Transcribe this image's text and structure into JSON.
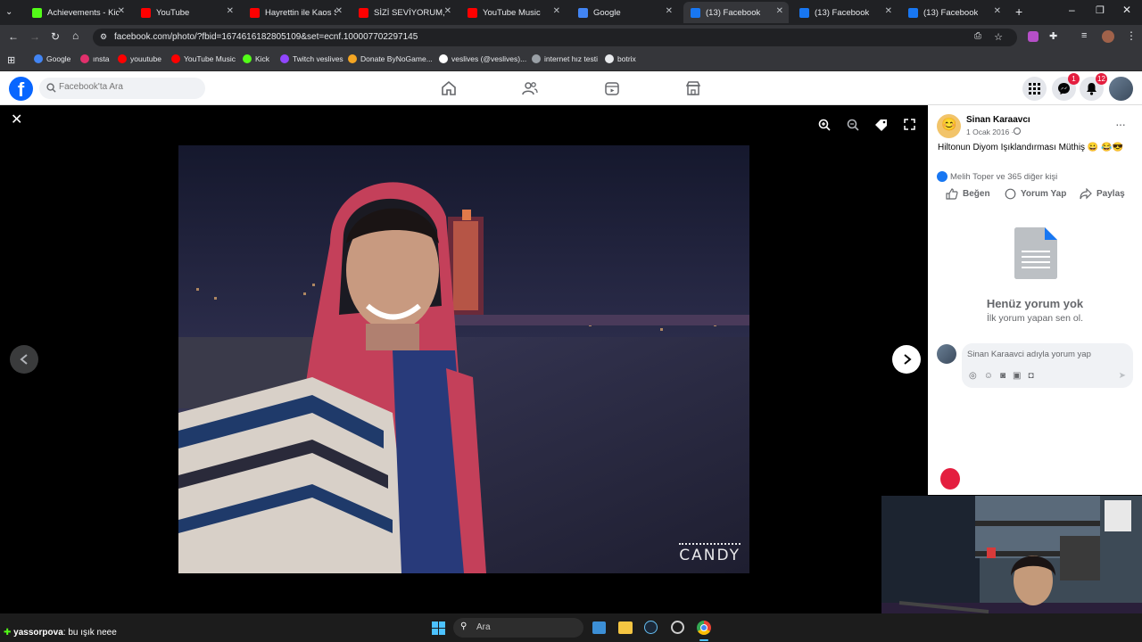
{
  "browser": {
    "tabs": [
      {
        "title": "Achievements - Kick",
        "color": "#53fc18",
        "active": false
      },
      {
        "title": "YouTube",
        "color": "#ff0000",
        "active": false
      },
      {
        "title": "Hayrettin ile Kaos Sh",
        "color": "#ff0000",
        "active": false
      },
      {
        "title": "SİZİ SEVİYORUM, SİZİ",
        "color": "#ff0000",
        "active": false
      },
      {
        "title": "YouTube Music",
        "color": "#ff0000",
        "active": false
      },
      {
        "title": "Google",
        "color": "#4285f4",
        "active": false
      },
      {
        "title": "(13) Facebook",
        "color": "#1877f2",
        "active": true
      },
      {
        "title": "(13) Facebook",
        "color": "#1877f2",
        "active": false
      },
      {
        "title": "(13) Facebook",
        "color": "#1877f2",
        "active": false
      }
    ],
    "url": "facebook.com/photo/?fbid=1674616182805109&set=ecnf.100007702297145",
    "bookmarks": [
      {
        "label": "Google",
        "color": "#4285f4"
      },
      {
        "label": "ınsta",
        "color": "#e1306c"
      },
      {
        "label": "youutube",
        "color": "#ff0000"
      },
      {
        "label": "YouTube Music",
        "color": "#ff0000"
      },
      {
        "label": "Kick",
        "color": "#53fc18"
      },
      {
        "label": "Twitch veslives",
        "color": "#9146ff"
      },
      {
        "label": "Donate ByNoGame...",
        "color": "#f5a623"
      },
      {
        "label": "veslives (@veslives)...",
        "color": "#ffffff"
      },
      {
        "label": "internet hız testi",
        "color": "#9aa0a6"
      },
      {
        "label": "botrix",
        "color": "#e8eaed"
      }
    ]
  },
  "facebook": {
    "logo": "f",
    "search_placeholder": "Facebook'ta Ara",
    "messenger_badge": "1",
    "notifications_badge": "12"
  },
  "viewer": {
    "watermark": "CANDY"
  },
  "post": {
    "author": "Sinan Karaavcı",
    "date": "1 Ocak 2016 ·",
    "caption": "Hiltonun Diyom Işıklandırması Müthiş 😀 😂😎",
    "reactions": "Melih Toper ve 365 diğer kişi",
    "like_label": "Beğen",
    "comment_label": "Yorum Yap",
    "share_label": "Paylaş",
    "no_comments_title": "Henüz yorum yok",
    "no_comments_sub": "İlk yorum yapan sen ol.",
    "comment_placeholder": "Sinan Karaavci adıyla yorum yap"
  },
  "taskbar": {
    "search_label": "Ara"
  },
  "chat_overlay": {
    "user": "yassorpova",
    "message": ": bu ışık neee"
  }
}
